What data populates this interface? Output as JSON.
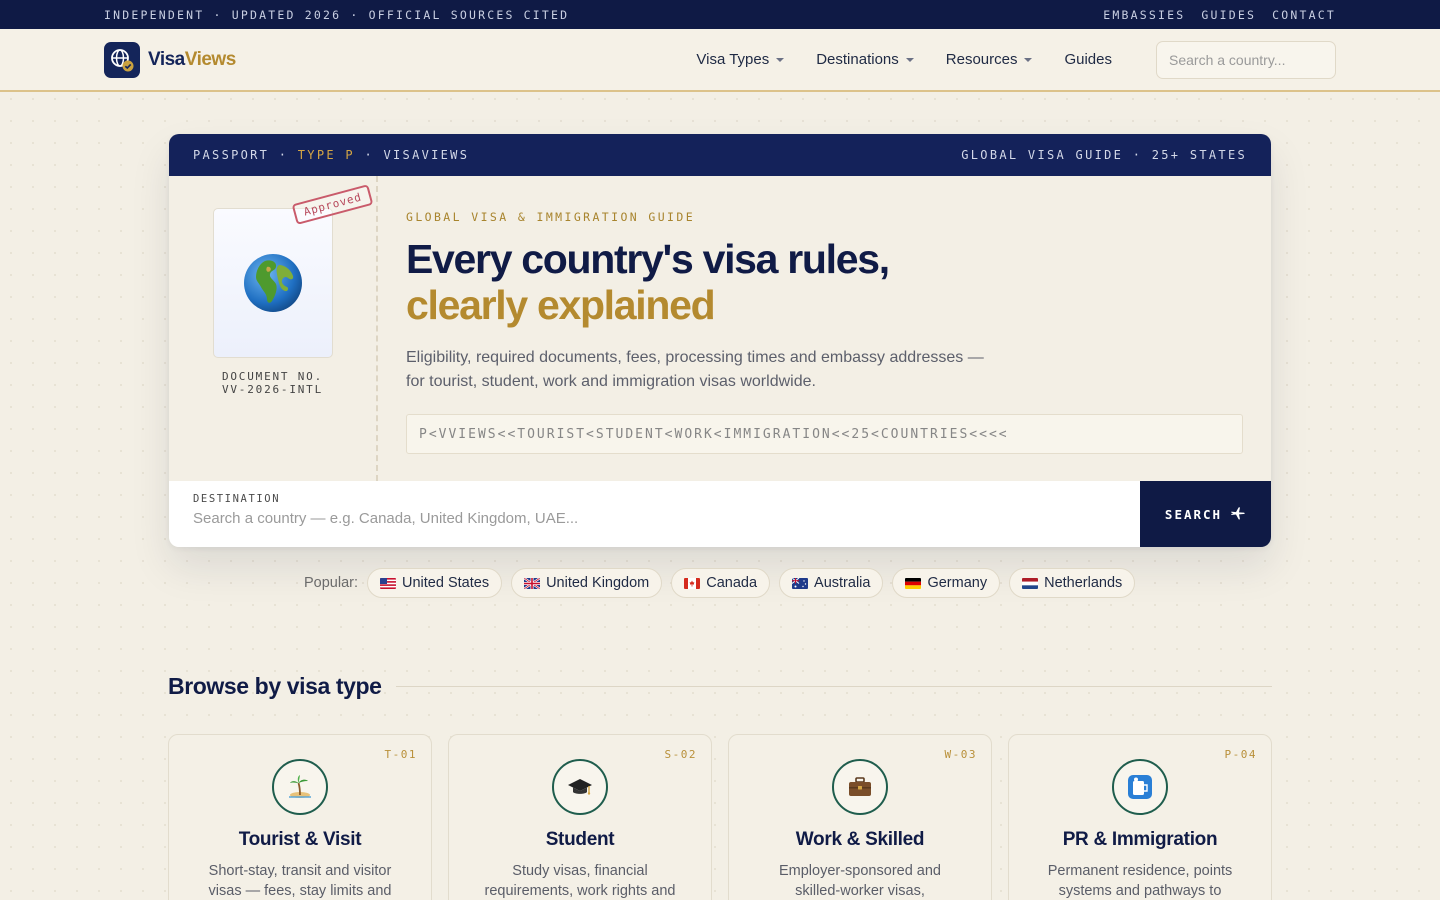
{
  "topbar": {
    "tagline": "INDEPENDENT · UPDATED 2026 · OFFICIAL SOURCES CITED",
    "links": [
      "EMBASSIES",
      "GUIDES",
      "CONTACT"
    ]
  },
  "header": {
    "logo_part1": "Visa",
    "logo_part2": "Views",
    "nav": [
      "Visa Types",
      "Destinations",
      "Resources",
      "Guides"
    ],
    "search_placeholder": "Search a country..."
  },
  "hero": {
    "bar_left_a": "PASSPORT · ",
    "bar_left_b": "TYPE P",
    "bar_left_c": " · VISAVIEWS",
    "bar_right": "GLOBAL VISA GUIDE · 25+ STATES",
    "stamp": "Approved",
    "doc_no_label": "DOCUMENT NO.",
    "doc_no": "VV-2026-INTL",
    "eyebrow": "GLOBAL VISA & IMMIGRATION GUIDE",
    "title_line1": "Every country's visa rules,",
    "title_line2": "clearly explained",
    "lede": "Eligibility, required documents, fees, processing times and embassy addresses — for tourist, student, work and immigration visas worldwide.",
    "mrz": "P<VVIEWS<<TOURIST<STUDENT<WORK<IMMIGRATION<<25<COUNTRIES<<<<",
    "dest_label": "DESTINATION",
    "dest_placeholder": "Search a country — e.g. Canada, United Kingdom, UAE...",
    "search_label": "SEARCH"
  },
  "popular": {
    "label": "Popular:",
    "chips": [
      "United States",
      "United Kingdom",
      "Canada",
      "Australia",
      "Germany",
      "Netherlands"
    ]
  },
  "browse": {
    "title": "Browse by visa type",
    "cards": [
      {
        "code": "T-01",
        "title": "Tourist & Visit",
        "desc": "Short-stay, transit and visitor visas — fees, stay limits and",
        "icon": "palm-island-icon"
      },
      {
        "code": "S-02",
        "title": "Student",
        "desc": "Study visas, financial requirements, work rights and",
        "icon": "graduation-cap-icon"
      },
      {
        "code": "W-03",
        "title": "Work & Skilled",
        "desc": "Employer-sponsored and skilled-worker visas, thresholds and",
        "icon": "briefcase-icon"
      },
      {
        "code": "P-04",
        "title": "PR & Immigration",
        "desc": "Permanent residence, points systems and pathways to",
        "icon": "passport-control-icon"
      }
    ]
  },
  "colors": {
    "navy": "#0f1a45",
    "gold": "#b48a2f",
    "cream": "#f3efe5",
    "teal": "#1f5d4d"
  }
}
